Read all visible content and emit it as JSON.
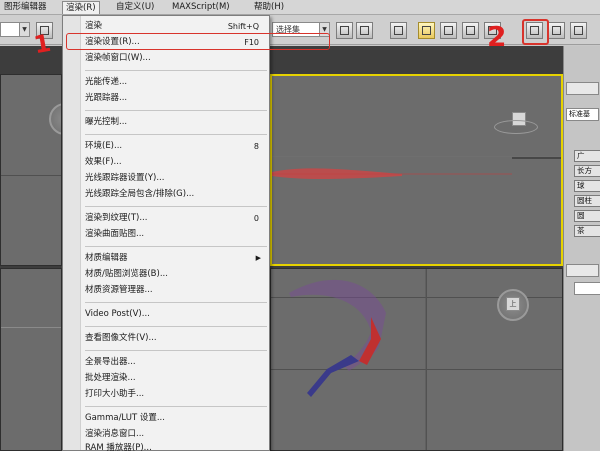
{
  "menubar": {
    "items": [
      {
        "label": "图形编辑器"
      },
      {
        "label": "渲染(R)"
      },
      {
        "label": "自定义(U)"
      },
      {
        "label": "MAXScript(M)"
      },
      {
        "label": "帮助(H)"
      }
    ]
  },
  "toolbar": {
    "dropdown_value": "选择集",
    "annotation_label": "2"
  },
  "render_menu": {
    "items": [
      {
        "label": "渲染",
        "shortcut": "Shift+Q"
      },
      {
        "label": "渲染设置(R)...",
        "shortcut": "F10"
      },
      {
        "label": "渲染帧窗口(W)..."
      },
      {
        "label": "光能传递..."
      },
      {
        "label": "光跟踪器..."
      },
      {
        "label": "曝光控制..."
      },
      {
        "label": "环境(E)...",
        "shortcut": "8"
      },
      {
        "label": "效果(F)..."
      },
      {
        "label": "光线跟踪器设置(Y)..."
      },
      {
        "label": "光线跟踪全局包含/排除(G)..."
      },
      {
        "label": "渲染到纹理(T)...",
        "shortcut": "0"
      },
      {
        "label": "渲染曲面贴图..."
      },
      {
        "label": "材质编辑器"
      },
      {
        "label": "材质/贴图浏览器(B)..."
      },
      {
        "label": "材质资源管理器..."
      },
      {
        "label": "Video Post(V)..."
      },
      {
        "label": "查看图像文件(V)..."
      },
      {
        "label": "全景导出器..."
      },
      {
        "label": "批处理渲染..."
      },
      {
        "label": "打印大小助手..."
      },
      {
        "label": "Gamma/LUT 设置..."
      },
      {
        "label": "渲染消息窗口..."
      },
      {
        "label": "RAM 播放器(P)..."
      }
    ]
  },
  "annotations": {
    "step1": "1",
    "step2": "2"
  },
  "viewport": {
    "nav_label": "上"
  },
  "command_panel": {
    "dropdown": "标准基",
    "rows": [
      "广",
      "长方",
      "球",
      "圆柱",
      "圆",
      "茶"
    ]
  },
  "colors": {
    "highlight_red": "#d8342c",
    "active_viewport_border": "#e6d200"
  }
}
